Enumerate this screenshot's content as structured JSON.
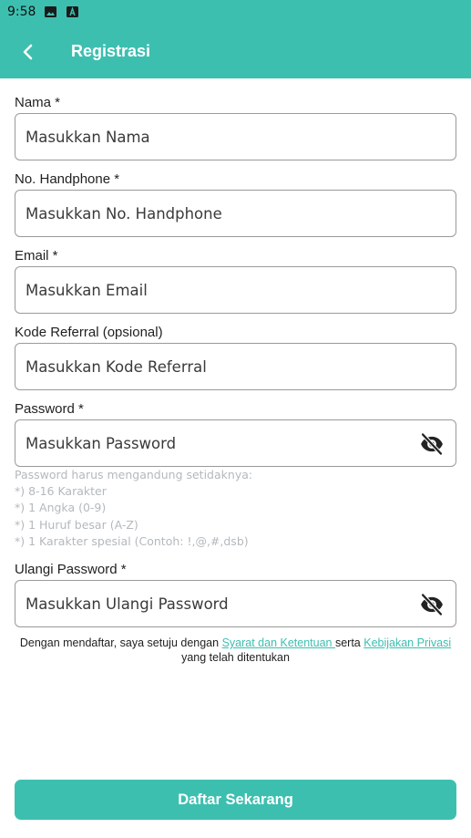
{
  "status_bar": {
    "time": "9:58",
    "icons": [
      "image-icon",
      "a-icon"
    ]
  },
  "header": {
    "title": "Registrasi",
    "back_icon": "chevron-left-icon"
  },
  "form": {
    "name": {
      "label": "Nama *",
      "placeholder": "Masukkan Nama",
      "value": ""
    },
    "phone": {
      "label": "No. Handphone *",
      "placeholder": "Masukkan No. Handphone",
      "value": ""
    },
    "email": {
      "label": "Email *",
      "placeholder": "Masukkan Email",
      "value": ""
    },
    "referral": {
      "label": "Kode Referral (opsional)",
      "placeholder": "Masukkan Kode Referral",
      "value": ""
    },
    "password": {
      "label": "Password *",
      "placeholder": "Masukkan Password",
      "value": "",
      "toggle_icon": "eye-off-icon"
    },
    "password_rules": {
      "intro": "Password harus mengandung setidaknya:",
      "items": [
        "*) 8-16 Karakter",
        "*) 1 Angka (0-9)",
        "*) 1 Huruf besar (A-Z)",
        "*) 1 Karakter spesial (Contoh: !,@,#,dsb)"
      ]
    },
    "confirm_password": {
      "label": "Ulangi Password *",
      "placeholder": "Masukkan Ulangi Password",
      "value": "",
      "toggle_icon": "eye-off-icon"
    }
  },
  "terms": {
    "prefix": "Dengan mendaftar, saya setuju dengan ",
    "link1": "Syarat dan Ketentuan ",
    "middle": "serta ",
    "link2": "Kebijakan Privasi",
    "suffix": "yang telah ditentukan"
  },
  "submit_label": "Daftar Sekarang",
  "colors": {
    "accent": "#3dbfb0",
    "hint_text": "#b4b9bd",
    "border": "#9a9a9a"
  }
}
